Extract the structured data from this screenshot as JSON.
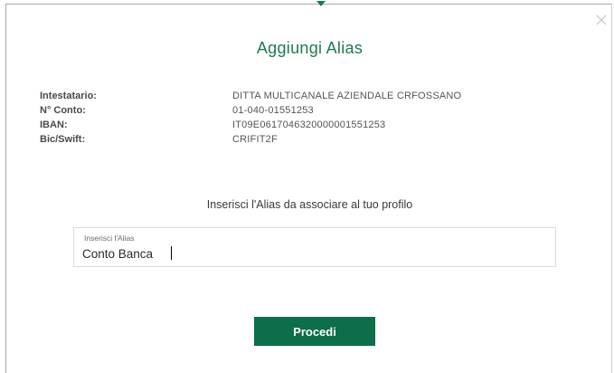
{
  "modal": {
    "title": "Aggiungi Alias",
    "close_icon": "close-icon"
  },
  "account": {
    "rows": [
      {
        "label": "Intestatario:",
        "value": "DITTA MULTICANALE AZIENDALE CRFOSSANO"
      },
      {
        "label": "N° Conto:",
        "value": "01-040-01551253"
      },
      {
        "label": "IBAN:",
        "value": "IT09E0617046320000001551253"
      },
      {
        "label": "Bic/Swift:",
        "value": "CRIFIT2F"
      }
    ]
  },
  "form": {
    "instruction": "Inserisci l'Alias da associare al tuo profilo",
    "alias_label": "Inserisci l'Alias",
    "alias_value": "Conto Banca",
    "submit_label": "Procedi"
  },
  "colors": {
    "accent": "#1f7a50",
    "button": "#0d6e4a"
  }
}
